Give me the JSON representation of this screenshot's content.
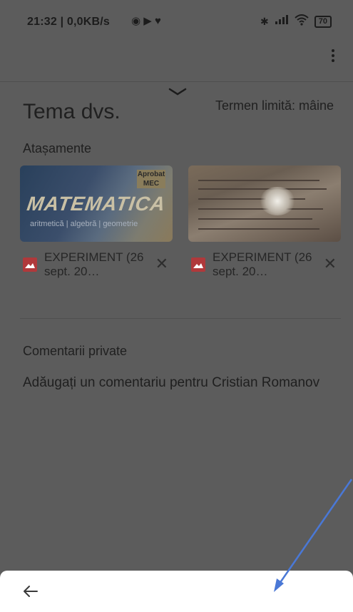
{
  "status_bar": {
    "time": "21:32",
    "network": "| 0,0KB/s",
    "battery": "70"
  },
  "assignment": {
    "title": "Tema dvs.",
    "due": "Termen limită: mâine"
  },
  "attachments": {
    "label": "Atașamente",
    "items": [
      {
        "name": "EXPERIMENT (26 sept. 20…",
        "thumb_text": "MATEMATICA",
        "thumb_sub": "aritmetică | algebră | geometrie",
        "badge": "Aprobat MEC"
      },
      {
        "name": "EXPERIMENT (26 sept. 20…"
      }
    ]
  },
  "private_comments": {
    "label": "Comentarii private",
    "placeholder": "Adăugați un comentariu pentru Cristian Romanov"
  },
  "colors": {
    "overlay": "#5c5c5c",
    "sheet": "#ffffff",
    "arrow": "#4a78d6",
    "image_icon": "#b0393b"
  },
  "icons": {
    "close": "close-icon",
    "back": "back-arrow-icon",
    "menu": "more-vert-icon",
    "collapse": "chevron-down-icon",
    "image": "image-file-icon"
  }
}
